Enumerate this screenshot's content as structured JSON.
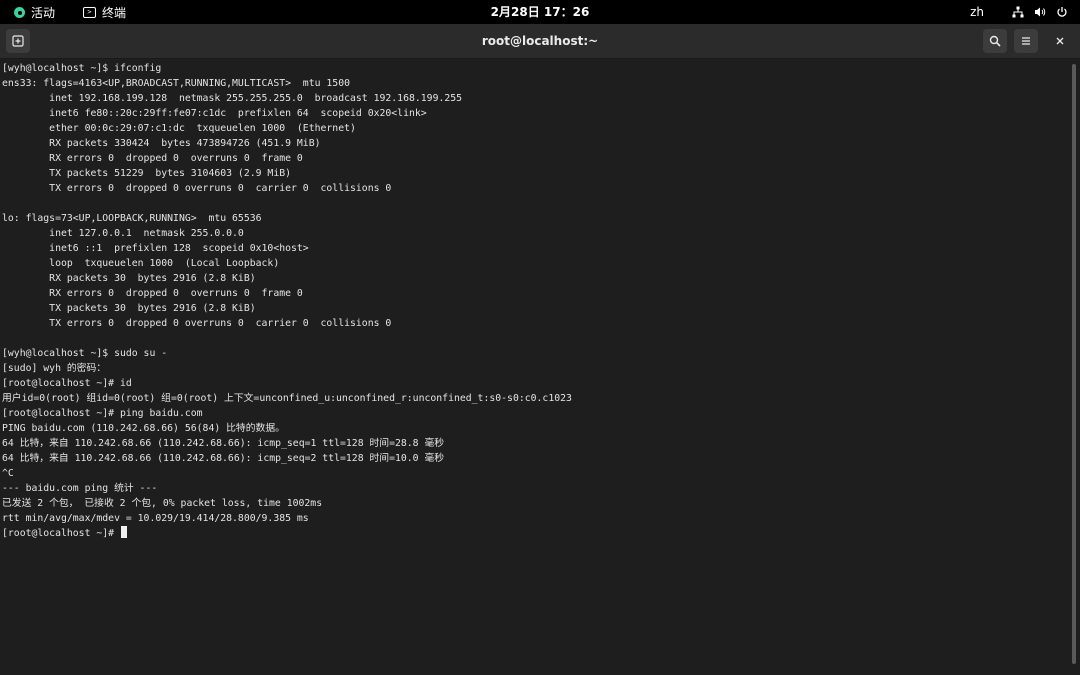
{
  "topbar": {
    "activities": "活动",
    "app_name": "终端",
    "clock": "2月28日  17：26",
    "lang": "zh",
    "icons": [
      "network-icon",
      "volume-icon",
      "power-icon"
    ]
  },
  "window": {
    "title": "root@localhost:~"
  },
  "terminal": {
    "lines": [
      "[wyh@localhost ~]$ ifconfig",
      "ens33: flags=4163<UP,BROADCAST,RUNNING,MULTICAST>  mtu 1500",
      "        inet 192.168.199.128  netmask 255.255.255.0  broadcast 192.168.199.255",
      "        inet6 fe80::20c:29ff:fe07:c1dc  prefixlen 64  scopeid 0x20<link>",
      "        ether 00:0c:29:07:c1:dc  txqueuelen 1000  (Ethernet)",
      "        RX packets 330424  bytes 473894726 (451.9 MiB)",
      "        RX errors 0  dropped 0  overruns 0  frame 0",
      "        TX packets 51229  bytes 3104603 (2.9 MiB)",
      "        TX errors 0  dropped 0 overruns 0  carrier 0  collisions 0",
      "",
      "lo: flags=73<UP,LOOPBACK,RUNNING>  mtu 65536",
      "        inet 127.0.0.1  netmask 255.0.0.0",
      "        inet6 ::1  prefixlen 128  scopeid 0x10<host>",
      "        loop  txqueuelen 1000  (Local Loopback)",
      "        RX packets 30  bytes 2916 (2.8 KiB)",
      "        RX errors 0  dropped 0  overruns 0  frame 0",
      "        TX packets 30  bytes 2916 (2.8 KiB)",
      "        TX errors 0  dropped 0 overruns 0  carrier 0  collisions 0",
      "",
      "[wyh@localhost ~]$ sudo su -",
      "[sudo] wyh 的密码：",
      "[root@localhost ~]# id",
      "用户id=0(root) 组id=0(root) 组=0(root) 上下文=unconfined_u:unconfined_r:unconfined_t:s0-s0:c0.c1023",
      "[root@localhost ~]# ping baidu.com",
      "PING baidu.com (110.242.68.66) 56(84) 比特的数据。",
      "64 比特，来自 110.242.68.66 (110.242.68.66): icmp_seq=1 ttl=128 时间=28.8 毫秒",
      "64 比特，来自 110.242.68.66 (110.242.68.66): icmp_seq=2 ttl=128 时间=10.0 毫秒",
      "^C",
      "--- baidu.com ping 统计 ---",
      "已发送 2 个包， 已接收 2 个包, 0% packet loss, time 1002ms",
      "rtt min/avg/max/mdev = 10.029/19.414/28.800/9.385 ms",
      "[root@localhost ~]# "
    ]
  },
  "colors": {
    "background": "#1e1e1e",
    "text": "#e3e3e3",
    "topbar": "#000000",
    "titlebar": "#2b2b2b",
    "activities_accent": "#3ad29f"
  }
}
